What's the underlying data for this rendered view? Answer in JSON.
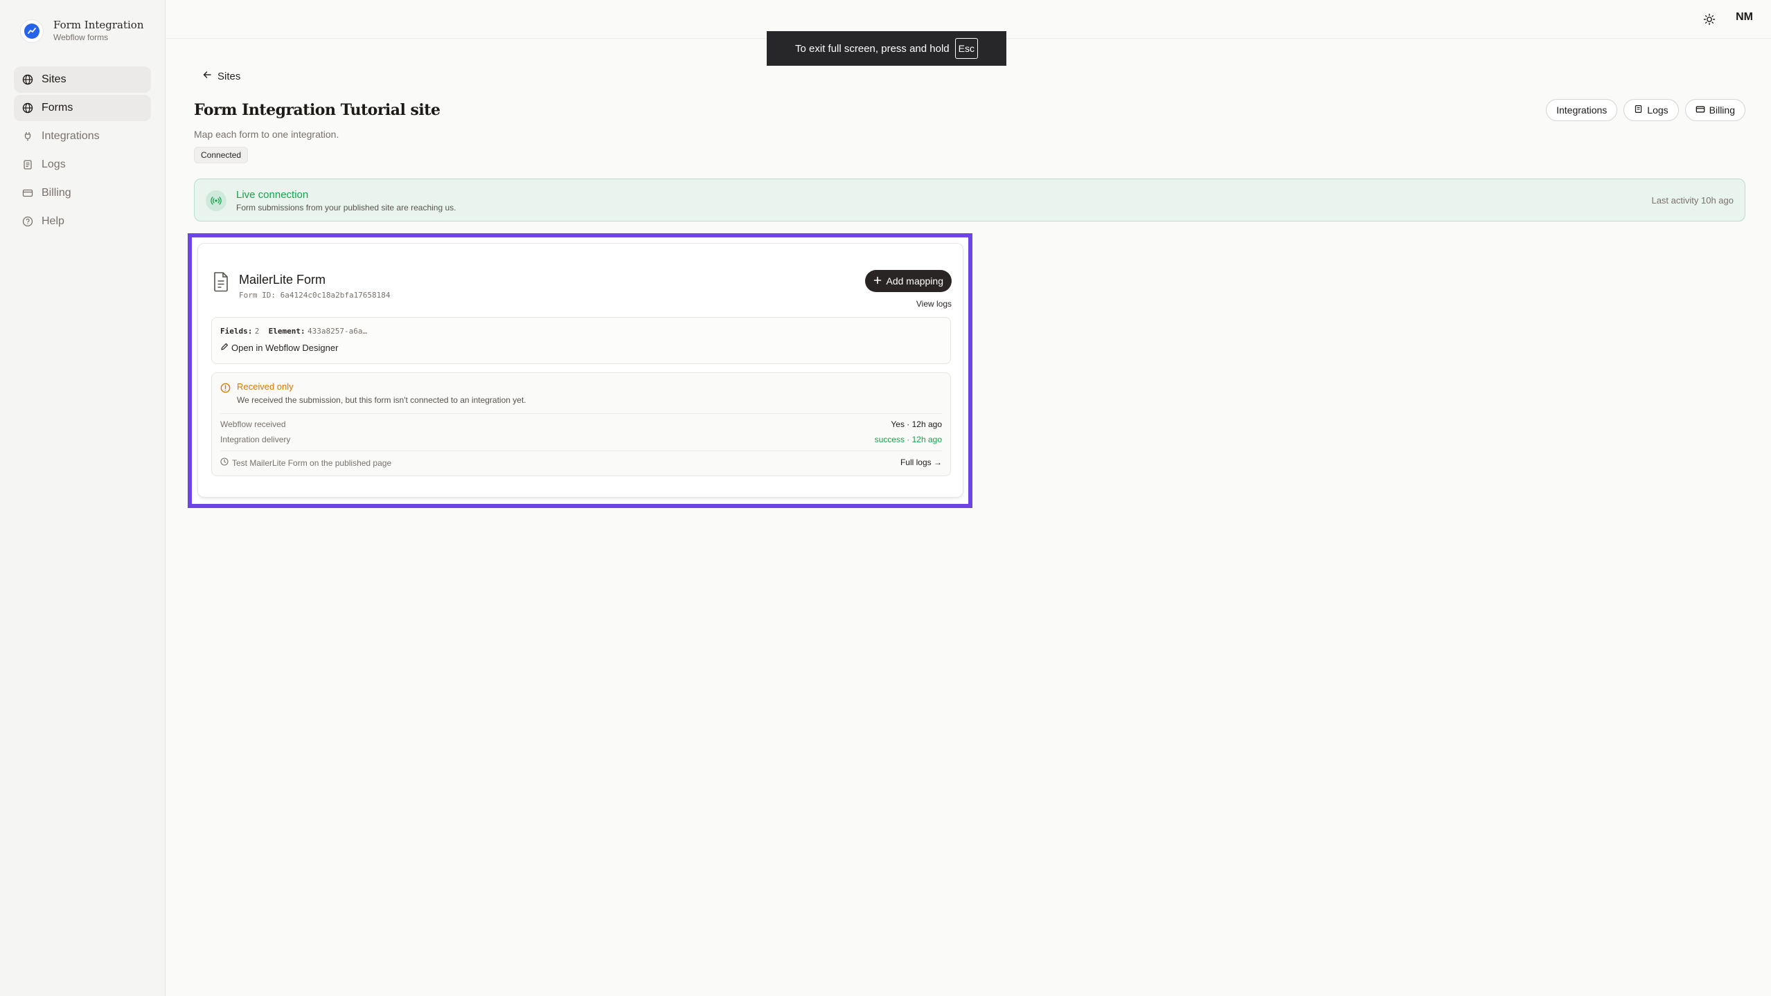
{
  "brand": {
    "title": "Form Integration",
    "subtitle": "Webflow forms"
  },
  "sidebar": {
    "items": [
      {
        "label": "Sites",
        "icon": "globe-icon",
        "active": true
      },
      {
        "label": "Forms",
        "icon": "globe-icon",
        "active": true
      },
      {
        "label": "Integrations",
        "icon": "plug-icon",
        "active": false
      },
      {
        "label": "Logs",
        "icon": "logs-icon",
        "active": false
      },
      {
        "label": "Billing",
        "icon": "card-icon",
        "active": false
      },
      {
        "label": "Help",
        "icon": "help-icon",
        "active": false
      }
    ]
  },
  "topbar": {
    "avatar": "NM"
  },
  "fullscreen_toast": {
    "text": "To exit full screen, press and hold",
    "key": "Esc"
  },
  "header": {
    "back_label": "Sites",
    "title": "Form Integration Tutorial site",
    "subtitle": "Map each form to one integration.",
    "badge": "Connected",
    "actions": [
      "Integrations",
      "Logs",
      "Billing"
    ]
  },
  "live": {
    "title": "Live connection",
    "subtitle": "Form submissions from your published site are reaching us.",
    "right": "Last activity 10h ago"
  },
  "form_card": {
    "title": "MailerLite Form",
    "form_id": "Form ID: 6a4124c0c18a2bfa17658184",
    "add_mapping": "Add mapping",
    "view_logs": "View logs",
    "fields_label": "Fields:",
    "fields_value": "2",
    "element_label": "Element:",
    "element_value": "433a8257-a6a…",
    "open_designer": "Open in Webflow Designer",
    "status_title": "Received only",
    "status_desc": "We received the submission, but this form isn't connected to an integration yet.",
    "rows": [
      {
        "label": "Webflow received",
        "value": "Yes · 12h ago"
      },
      {
        "label": "Integration delivery",
        "value": "success · 12h ago"
      }
    ],
    "test_text": "Test MailerLite Form on the published page",
    "full_logs": "Full logs →"
  },
  "colors": {
    "accent_highlight": "#6d44e6",
    "success": "#16a34a",
    "warning": "#d97706"
  }
}
